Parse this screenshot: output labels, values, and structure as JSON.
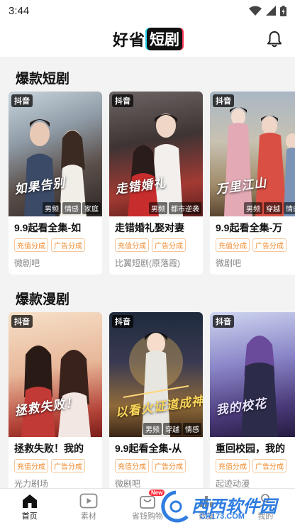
{
  "status_bar": {
    "time": "3:44"
  },
  "header": {
    "logo_part1": "好省",
    "logo_part2": "短剧"
  },
  "sections": [
    {
      "title": "爆款短剧",
      "cards": [
        {
          "platform": "抖音",
          "cover_title": "如果告别",
          "tags": [
            "男频",
            "情感",
            "家庭"
          ],
          "title": "9.9起看全集-如",
          "chips": [
            "充值分成",
            "广告分成"
          ],
          "source": "微剧吧"
        },
        {
          "platform": "抖音",
          "cover_title": "走错婚礼",
          "tags": [
            "男频",
            "都市逆袭"
          ],
          "title": "走错婚礼娶对妻",
          "chips": [
            "充值分成",
            "广告分成"
          ],
          "source": "比翼短剧(原落霞)"
        },
        {
          "platform": "抖音",
          "cover_title": "万里江山",
          "tags": [
            "男频",
            "穿越",
            "情感"
          ],
          "title": "9.9起看全集-万",
          "chips": [
            "充值分成",
            "广告分成"
          ],
          "source": "微剧吧"
        }
      ]
    },
    {
      "title": "爆款漫剧",
      "cards": [
        {
          "platform": "抖音",
          "cover_title": "拯救失败！",
          "tags": [],
          "title": "拯救失败！我的",
          "chips": [
            "充值分成",
            "广告分成"
          ],
          "source": "光力剧场"
        },
        {
          "platform": "抖音",
          "cover_title": "以看火证道成神",
          "tags": [
            "男频",
            "穿越",
            "情感"
          ],
          "title": "9.9起看全集-从",
          "chips": [
            "充值分成",
            "广告分成"
          ],
          "source": "微剧吧"
        },
        {
          "platform": "抖音",
          "cover_title": "我的校花",
          "tags": [],
          "title": "重回校园，我的",
          "chips": [
            "充值分成",
            "广告分成"
          ],
          "source": "起迹动漫"
        }
      ]
    }
  ],
  "tabbar": {
    "items": [
      {
        "label": "首页",
        "icon": "home-icon",
        "active": true
      },
      {
        "label": "素材",
        "icon": "video-play-icon"
      },
      {
        "label": "省钱购物",
        "icon": "shopping-icon",
        "badge": "New"
      },
      {
        "label": "数据",
        "icon": "chart-icon"
      },
      {
        "label": "我的",
        "icon": "user-icon"
      }
    ]
  },
  "watermark": {
    "title": "西西软件园",
    "subtitle": "CR173.COM"
  },
  "colors": {
    "accent_orange": "#f08a2c",
    "badge_red": "#ff2d3d",
    "watermark_blue": "#2f7de1"
  }
}
